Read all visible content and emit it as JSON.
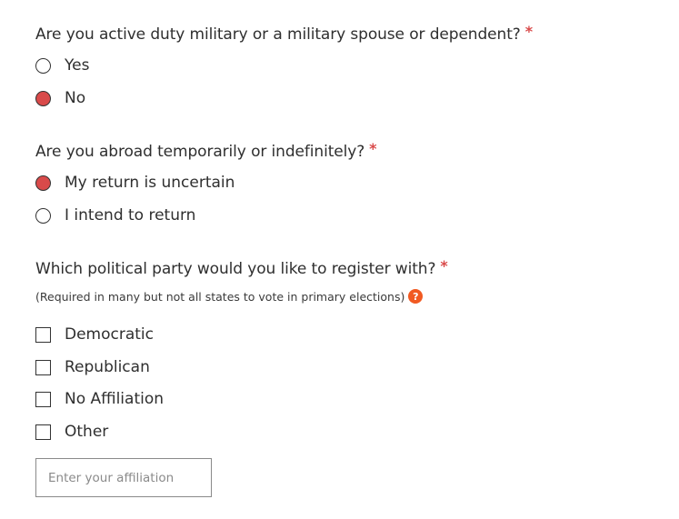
{
  "colors": {
    "accent": "#d94a4a",
    "required": "#d94a4a",
    "help": "#f15a22"
  },
  "q_military": {
    "label": "Are you active duty military or a military spouse or dependent?",
    "required_mark": "*",
    "options": [
      {
        "label": "Yes",
        "selected": false
      },
      {
        "label": "No",
        "selected": true
      }
    ]
  },
  "q_abroad": {
    "label": "Are you abroad temporarily or indefinitely?",
    "required_mark": "*",
    "options": [
      {
        "label": "My return is uncertain",
        "selected": true
      },
      {
        "label": "I intend to return",
        "selected": false
      }
    ]
  },
  "q_party": {
    "label": "Which political party would you like to register with?",
    "required_mark": "*",
    "note": "(Required in many but not all states to vote in primary elections)",
    "help_icon": "question-circle-icon",
    "help_glyph": "?",
    "options": [
      {
        "label": "Democratic",
        "checked": false
      },
      {
        "label": "Republican",
        "checked": false
      },
      {
        "label": "No Affiliation",
        "checked": false
      },
      {
        "label": "Other",
        "checked": false
      }
    ],
    "affiliation_input": {
      "value": "",
      "placeholder": "Enter your affiliation"
    }
  }
}
